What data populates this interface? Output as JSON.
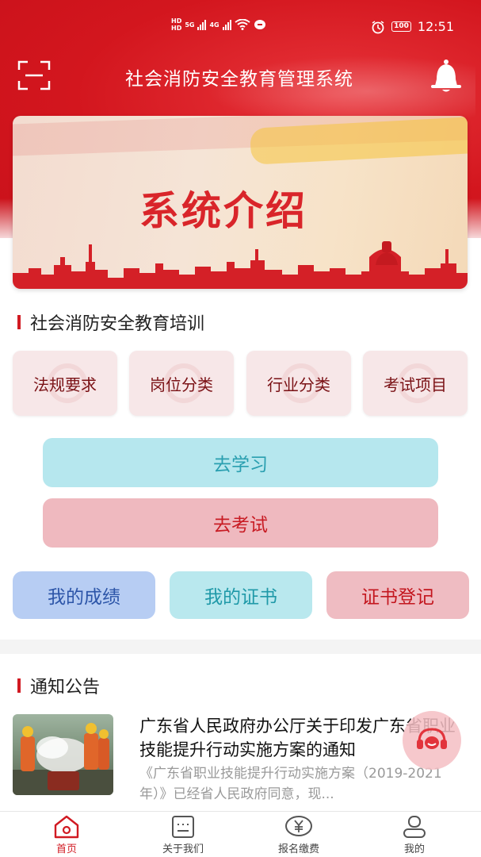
{
  "status_bar": {
    "net_a": "HD",
    "net_b": "HD",
    "gen1": "5G",
    "gen2": "4G",
    "battery": "100",
    "time": "12:51"
  },
  "header": {
    "title": "社会消防安全教育管理系统"
  },
  "banner": {
    "title": "系统介绍"
  },
  "training": {
    "heading": "社会消防安全教育培训",
    "categories": [
      {
        "label": "法规要求"
      },
      {
        "label": "岗位分类"
      },
      {
        "label": "行业分类"
      },
      {
        "label": "考试项目"
      }
    ],
    "study_label": "去学习",
    "exam_label": "去考试"
  },
  "actions": {
    "score_label": "我的成绩",
    "cert_label": "我的证书",
    "register_label": "证书登记"
  },
  "notices": {
    "heading": "通知公告",
    "items": [
      {
        "title": "广东省人民政府办公厅关于印发广东省职业技能提升行动实施方案的通知",
        "desc": "《广东省职业技能提升行动实施方案（2019-2021年）》已经省人民政府同意，现..."
      }
    ]
  },
  "bottom_nav": [
    {
      "label": "首页",
      "icon": "home-icon",
      "active": true
    },
    {
      "label": "关于我们",
      "icon": "about-icon",
      "active": false
    },
    {
      "label": "报名缴费",
      "icon": "payment-icon",
      "active": false
    },
    {
      "label": "我的",
      "icon": "profile-icon",
      "active": false
    }
  ],
  "colors": {
    "brand_red": "#d11a22",
    "study_bg": "#b6e7ee",
    "exam_bg": "#efb9bf",
    "score_bg": "#b7cdf3"
  }
}
